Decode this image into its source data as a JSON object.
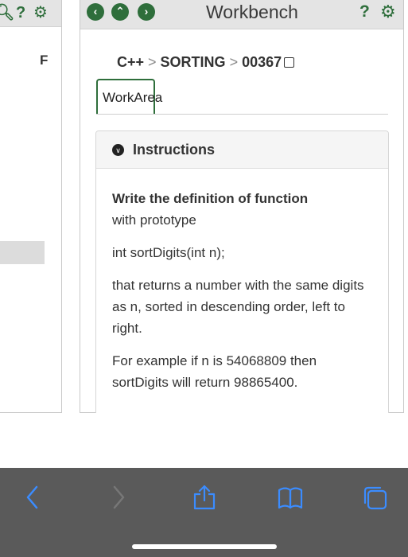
{
  "left_panel": {
    "f_label": "F"
  },
  "header": {
    "title": "Workbench",
    "help_glyph": "?"
  },
  "breadcrumb": {
    "items": [
      "C++",
      "SORTING",
      "00367"
    ],
    "separator": ">"
  },
  "tabs": {
    "active_label": "WorkArea"
  },
  "instructions": {
    "title": "Instructions",
    "bold_lead": "Write the definition of function",
    "line1_rest": "with prototype",
    "prototype": "int sortDigits(int n);",
    "para2": "that returns a number with the same digits as n, sorted in descending order, left to right.",
    "para3": "For example if n is 54068809  then sortDigits will return 98865400."
  },
  "colors": {
    "accent_green": "#2e6e3b",
    "toolbar_bg": "#5a5a5a",
    "toolbar_active_icon": "#3b8cff",
    "toolbar_disabled_icon": "#777777"
  },
  "toolbar": {
    "icons": [
      "back-icon",
      "forward-icon",
      "share-icon",
      "bookmarks-icon",
      "tabs-icon"
    ]
  }
}
